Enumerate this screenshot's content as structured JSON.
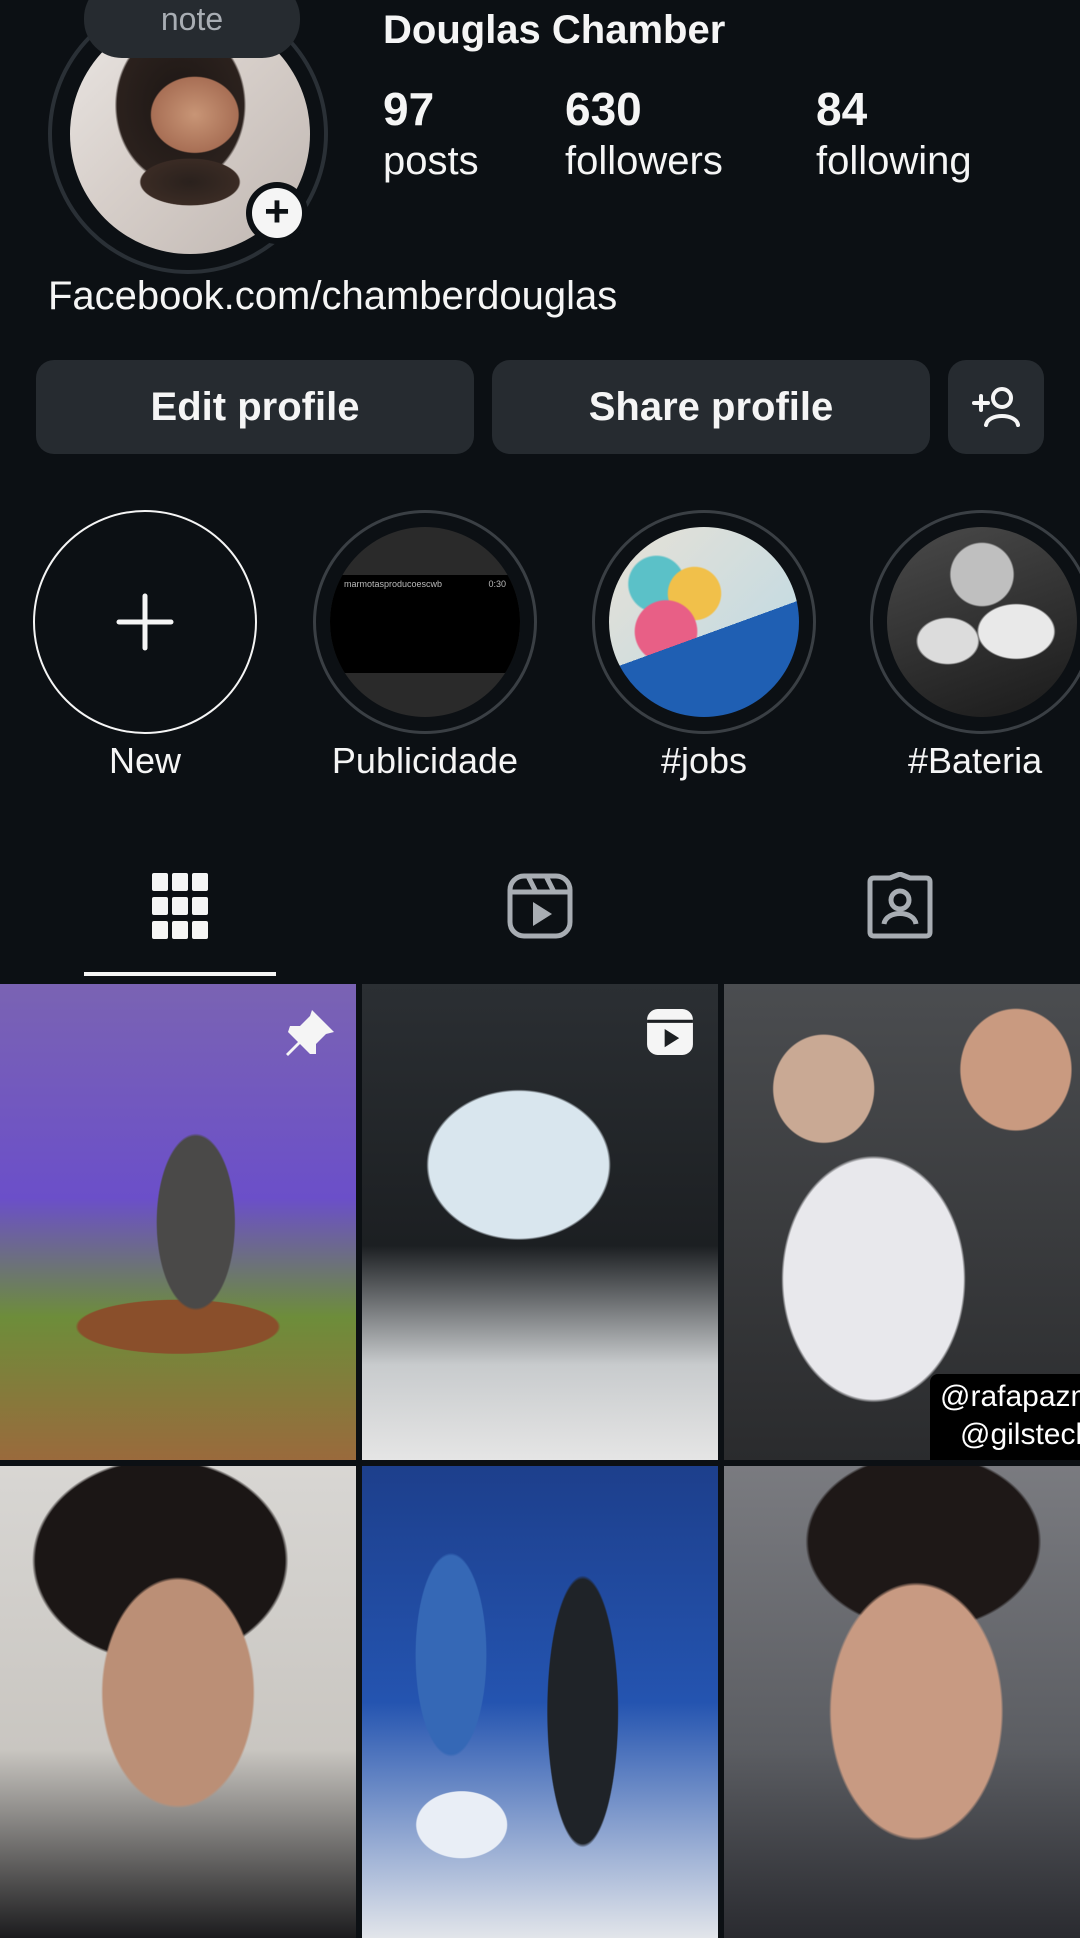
{
  "profile": {
    "note_label": "note",
    "name": "Douglas Chamber",
    "stats": {
      "posts": {
        "value": "97",
        "label": "posts"
      },
      "followers": {
        "value": "630",
        "label": "followers"
      },
      "following": {
        "value": "84",
        "label": "following"
      }
    },
    "bio_link": "Facebook.com/chamberdouglas"
  },
  "actions": {
    "edit_label": "Edit profile",
    "share_label": "Share profile",
    "discover_icon": "add-person-icon"
  },
  "highlights": [
    {
      "label": "New",
      "icon": "plus-icon"
    },
    {
      "label": "Publicidade",
      "thumb_text": "marmotasproducoescwb",
      "thumb_time": "0:30"
    },
    {
      "label": "#jobs"
    },
    {
      "label": "#Bateria"
    }
  ],
  "tabs": [
    {
      "icon": "grid-icon",
      "selected": true
    },
    {
      "icon": "reels-icon",
      "selected": false
    },
    {
      "icon": "tagged-icon",
      "selected": false
    }
  ],
  "posts": [
    {
      "kind": "photo",
      "pinned": true
    },
    {
      "kind": "reel",
      "pinned": false
    },
    {
      "kind": "photo",
      "pinned": false,
      "overlay_text": [
        "@rafapazma",
        "@gilsteckl"
      ]
    },
    {
      "kind": "photo",
      "pinned": false
    },
    {
      "kind": "photo",
      "pinned": false
    },
    {
      "kind": "photo",
      "pinned": false
    }
  ],
  "colors": {
    "background": "#0c1014",
    "button": "#262b30",
    "text": "#f5f5f5",
    "muted": "#a8adb3"
  }
}
